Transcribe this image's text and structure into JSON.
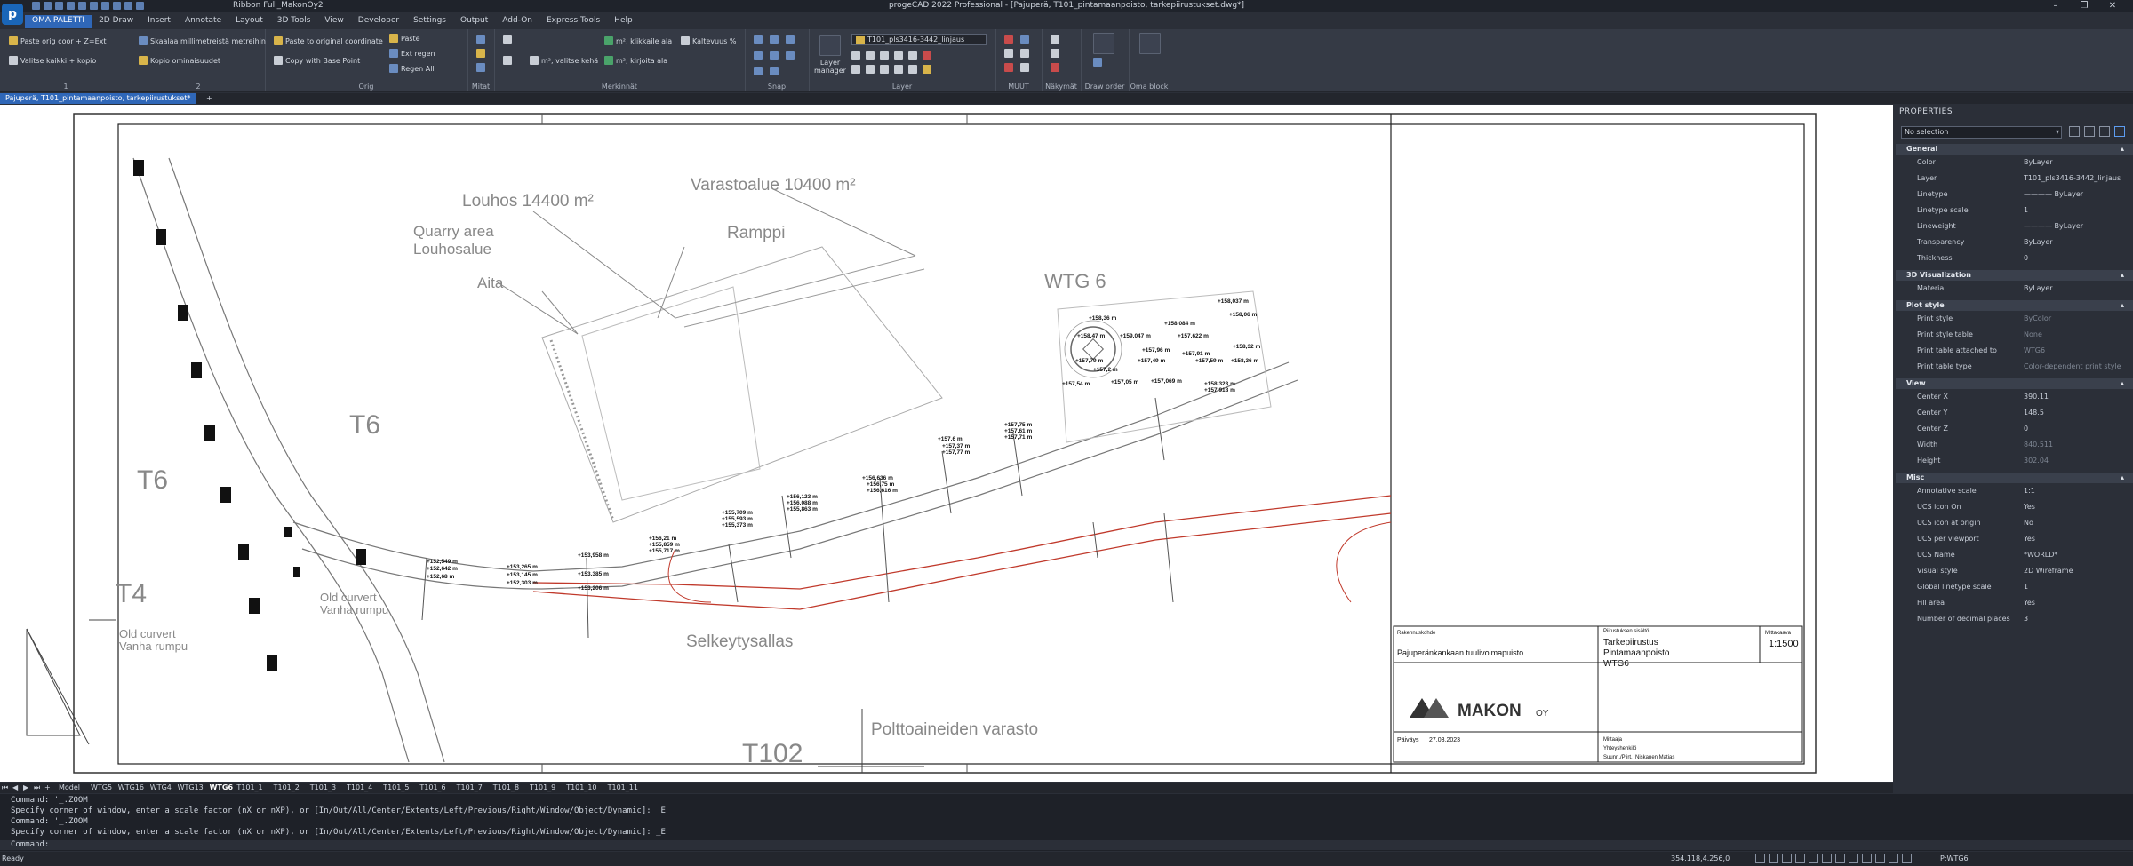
{
  "app": {
    "title": "progeCAD 2022 Professional - [Pajuperä, T101_pintamaanpoisto, tarkepiirustukset.dwg*]",
    "workspace": "Ribbon Full_MakonOy2",
    "logo_letter": "p"
  },
  "window_controls": {
    "minimize": "–",
    "restore": "❐",
    "close": "✕"
  },
  "menu_tabs": [
    "OMA PALETTI",
    "2D Draw",
    "Insert",
    "Annotate",
    "Layout",
    "3D Tools",
    "View",
    "Developer",
    "Settings",
    "Output",
    "Add-On",
    "Express Tools",
    "Help"
  ],
  "ribbon": {
    "p1": {
      "b1": "Paste orig coor + Z=Ext",
      "b2": "Valitse kaikki + kopio",
      "label": "1"
    },
    "p2": {
      "b1": "Skaalaa millimetreistä metreihin",
      "b2": "Kopio ominaisuudet",
      "label": "2"
    },
    "p3": {
      "b1": "Paste to original coordinate",
      "b2": "Copy with Base Point",
      "b3": "Paste",
      "b4": "Ext regen",
      "b5": "Regen All",
      "label": "Orig"
    },
    "p4": {
      "label": "Mitat"
    },
    "p5": {
      "b1": "m², klikkaile ala",
      "b2": "Kaltevuus %",
      "b3": "m², valitse kehä",
      "b4": "m², kirjoita ala",
      "label": "Merkinnät"
    },
    "p6": {
      "label": "Snap"
    },
    "p7": {
      "b1": "Layer manager",
      "layer_name": "T101_pls3416-3442_linjaus",
      "label": "Layer"
    },
    "p8": {
      "label": "MUUT"
    },
    "p9": {
      "label": "Näkymät"
    },
    "p10": {
      "label": "Draw order"
    },
    "p11": {
      "label": "Oma block"
    }
  },
  "doc_tab": {
    "label": "Pajuperä, T101_pintamaanpoisto, tarkepiirustukset*",
    "plus": "+"
  },
  "drawing": {
    "labels": {
      "louhos": "Louhos 14400 m²",
      "varasto": "Varastoalue 10400 m²",
      "quarry": "Quarry area",
      "louhosalue": "Louhosalue",
      "ramppi": "Ramppi",
      "aita": "Aita",
      "wtg6": "WTG 6",
      "t6a": "T6",
      "t6b": "T6",
      "t4": "T4",
      "oldculvert1": "Old curvert",
      "vanharumpu1": "Vanha rumpu",
      "oldculvert2": "Old curvert",
      "vanharumpu2": "Vanha rumpu",
      "selkeytys": "Selkeytysallas",
      "polttoaine": "Polttoaineiden varasto",
      "t102": "T102"
    },
    "elevations": [
      "+158,037 m",
      "+158,36 m",
      "+158,084 m",
      "+158,06 m",
      "+158,47 m",
      "+159,047 m",
      "+157,622 m",
      "+157,96 m",
      "+158,32 m",
      "+157,91 m",
      "+157,79 m",
      "+157,49 m",
      "+157,59 m",
      "+158,36 m",
      "+157,2 m",
      "+157,54 m",
      "+157,05 m",
      "+157,069 m",
      "+158,323 m",
      "+157,918 m",
      "+157,75 m",
      "+157,61 m",
      "+157,71 m",
      "+157,6 m",
      "+157,37 m",
      "+157,77 m",
      "+156,636 m",
      "+156,75 m",
      "+156,616 m",
      "+156,123 m",
      "+156,088 m",
      "+155,863 m",
      "+155,709 m",
      "+155,593 m",
      "+155,373 m",
      "+156,21 m",
      "+155,859 m",
      "+155,717 m",
      "+153,958 m",
      "+153,385 m",
      "+153,206 m",
      "+153,265 m",
      "+153,145 m",
      "+152,303 m",
      "+152,549 m",
      "+152,642 m",
      "+152,68 m"
    ],
    "title_block": {
      "rakennuskohde_label": "Rakennuskohde",
      "rakennuskohde": "Pajuperänkankaan tuulivoimapuisto",
      "piirustus_label": "Piirustuksen sisältö",
      "line1": "Tarkepiirustus",
      "line2": "Pintamaanpoisto",
      "line3": "WTG6",
      "mittakaava_label": "Mittakaava",
      "scale": "1:1500",
      "company": "MAKON",
      "company_suffix": "OY",
      "paivays_label": "Päiväys",
      "date": "27.03.2023",
      "mittaaja_label": "Mittaaja",
      "yhteys_label": "Yhteyshenkilö",
      "suunn_label": "Suunn./Piirt.",
      "designer": "Niskanen Matias"
    }
  },
  "properties": {
    "header": "PROPERTIES",
    "selection": "No selection",
    "groups": {
      "general": "General",
      "vis3d": "3D Visualization",
      "plot": "Plot style",
      "view": "View",
      "misc": "Misc"
    },
    "general": [
      {
        "k": "Color",
        "v": "ByLayer"
      },
      {
        "k": "Layer",
        "v": "T101_pls3416-3442_linjaus"
      },
      {
        "k": "Linetype",
        "v": "———— ByLayer"
      },
      {
        "k": "Linetype scale",
        "v": "1"
      },
      {
        "k": "Lineweight",
        "v": "———— ByLayer"
      },
      {
        "k": "Transparency",
        "v": "ByLayer"
      },
      {
        "k": "Thickness",
        "v": "0"
      }
    ],
    "vis3d": [
      {
        "k": "Material",
        "v": "ByLayer"
      }
    ],
    "plot": [
      {
        "k": "Print style",
        "v": "ByColor"
      },
      {
        "k": "Print style table",
        "v": "None"
      },
      {
        "k": "Print table attached to",
        "v": "WTG6"
      },
      {
        "k": "Print table type",
        "v": "Color-dependent print style"
      }
    ],
    "view": [
      {
        "k": "Center X",
        "v": "390.11"
      },
      {
        "k": "Center Y",
        "v": "148.5"
      },
      {
        "k": "Center Z",
        "v": "0"
      },
      {
        "k": "Width",
        "v": "840.511"
      },
      {
        "k": "Height",
        "v": "302.04"
      }
    ],
    "misc": [
      {
        "k": "Annotative scale",
        "v": "1:1"
      },
      {
        "k": "UCS icon On",
        "v": "Yes"
      },
      {
        "k": "UCS icon at origin",
        "v": "No"
      },
      {
        "k": "UCS per viewport",
        "v": "Yes"
      },
      {
        "k": "UCS Name",
        "v": "*WORLD*"
      },
      {
        "k": "Visual style",
        "v": "2D Wireframe"
      },
      {
        "k": "Global linetype scale",
        "v": "1"
      },
      {
        "k": "Fill area",
        "v": "Yes"
      },
      {
        "k": "Number of decimal places",
        "v": "3"
      }
    ]
  },
  "layout_tabs": [
    "Model",
    "WTG5",
    "WTG16",
    "WTG4",
    "WTG13",
    "WTG6",
    "T101_1",
    "T101_2",
    "T101_3",
    "T101_4",
    "T101_5",
    "T101_6",
    "T101_7",
    "T101_8",
    "T101_9",
    "T101_10",
    "T101_11"
  ],
  "active_layout": "WTG6",
  "command": {
    "lines": [
      "Command: '_.ZOOM",
      "Specify corner of window, enter a scale factor (nX or nXP), or [In/Out/All/Center/Extents/Left/Previous/Right/Window/Object/Dynamic]: _E",
      "Command: '_.ZOOM",
      "Specify corner of window, enter a scale factor (nX or nXP), or [In/Out/All/Center/Extents/Left/Previous/Right/Window/Object/Dynamic]: _E"
    ],
    "prompt": "Command:"
  },
  "status": {
    "ready": "Ready",
    "coords": "354.118,4.256,0",
    "model": "P:WTG6"
  }
}
